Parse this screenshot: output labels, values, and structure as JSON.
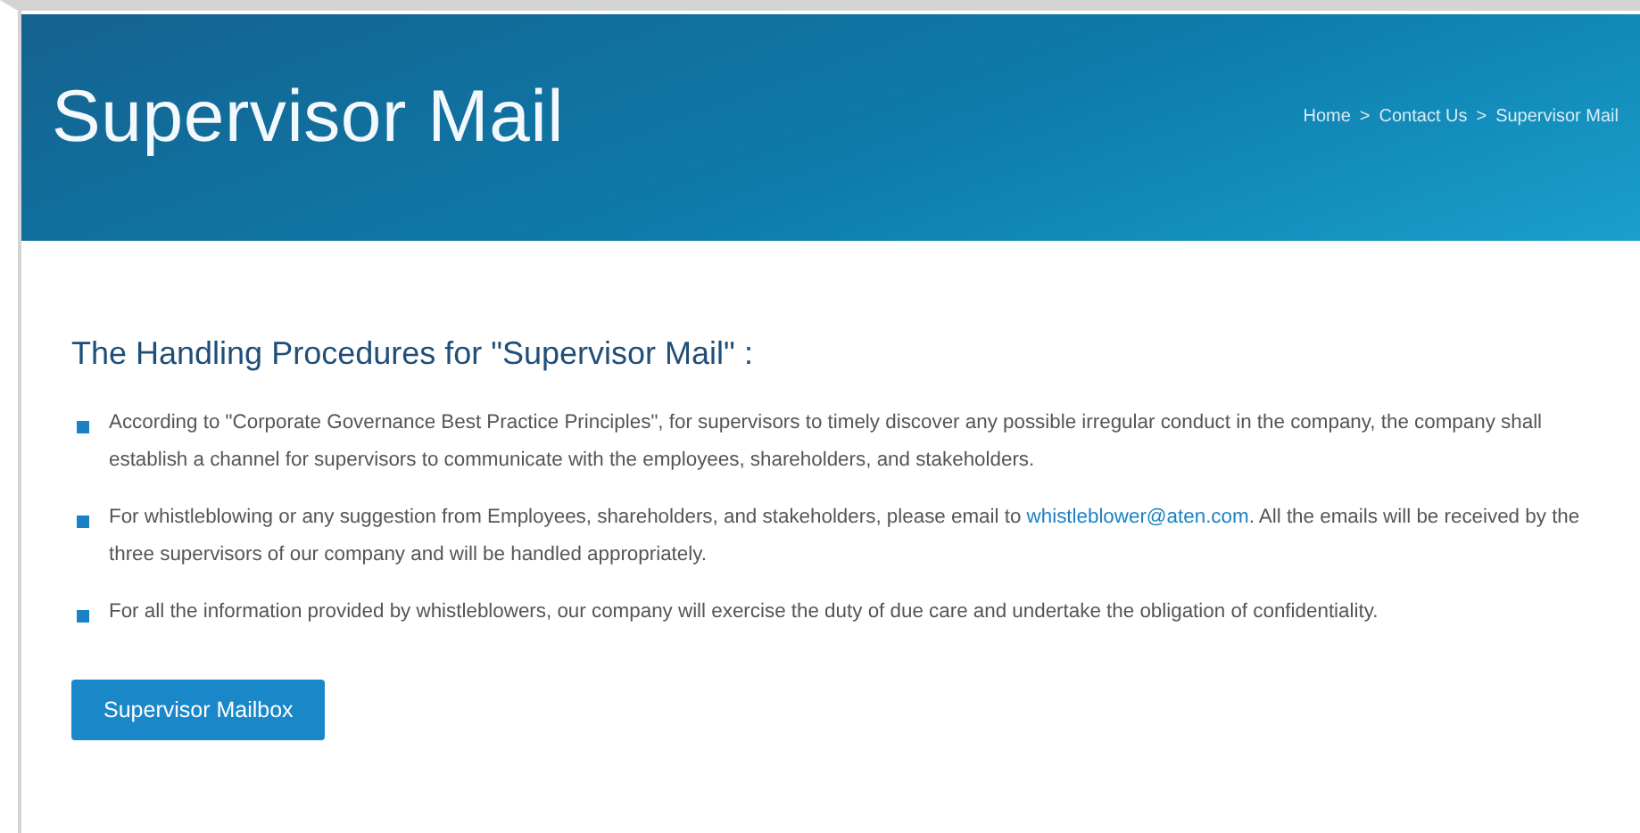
{
  "banner": {
    "title": "Supervisor Mail",
    "breadcrumb": [
      {
        "label": "Home"
      },
      {
        "label": "Contact Us"
      },
      {
        "label": "Supervisor Mail"
      }
    ],
    "separator": ">"
  },
  "heading": "The Handling Procedures for \"Supervisor Mail\" :",
  "items": [
    [
      {
        "kind": "text",
        "text": "According to \"Corporate Governance Best Practice Principles\", for supervisors to timely discover any possible irregular conduct in the company, the company shall establish a channel for supervisors to communicate with the employees, shareholders, and stakeholders."
      }
    ],
    [
      {
        "kind": "text",
        "text": "For whistleblowing or any suggestion from Employees, shareholders, and stakeholders, please email to "
      },
      {
        "kind": "link",
        "text": "whistleblower@aten.com"
      },
      {
        "kind": "text",
        "text": ". All the emails will be received by the three supervisors of our company and will be handled appropriately."
      }
    ],
    [
      {
        "kind": "text",
        "text": "For all the information provided by whistleblowers, our company will exercise the duty of due care and undertake the obligation of confidentiality."
      }
    ]
  ],
  "button": "Supervisor Mailbox"
}
